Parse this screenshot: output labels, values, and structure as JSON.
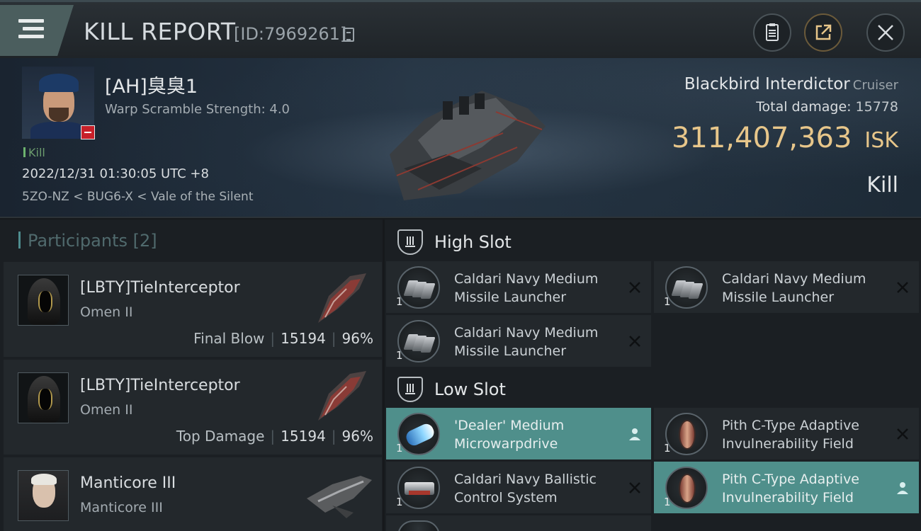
{
  "header": {
    "title": "KILL REPORT",
    "report_id": "[ID:7969261]",
    "icons": [
      "menu-icon",
      "copy-icon",
      "document-icon",
      "share-icon",
      "close-icon"
    ]
  },
  "victim": {
    "name": "[AH]臭臭1",
    "warp_scramble": "Warp Scramble Strength: 4.0",
    "tag": "Kill",
    "timestamp": "2022/12/31 01:30:05 UTC +8",
    "location": "5ZO-NZ < BUG6-X < Vale of the Silent",
    "ship_name": "Blackbird Interdictor",
    "ship_class": "Cruiser",
    "total_damage_label": "Total damage:",
    "total_damage": "15778",
    "isk_value": "311,407,363",
    "isk_unit": "ISK",
    "result": "Kill"
  },
  "participants": {
    "header": "Participants [2]",
    "items": [
      {
        "name": "[LBTY]TieInterceptor",
        "ship": "Omen II",
        "role": "Final Blow",
        "damage": "15194",
        "percent": "96%"
      },
      {
        "name": "[LBTY]TieInterceptor",
        "ship": "Omen II",
        "role": "Top Damage",
        "damage": "15194",
        "percent": "96%"
      },
      {
        "name": "Manticore III",
        "ship": "Manticore III"
      }
    ]
  },
  "fittings": {
    "high_slot": {
      "label": "High Slot",
      "modules": [
        {
          "name": "Caldari Navy Medium Missile Launcher",
          "qty": "1",
          "action_icon": "close-icon"
        },
        {
          "name": "Caldari Navy Medium Missile Launcher",
          "qty": "1",
          "action_icon": "close-icon"
        },
        {
          "name": "Caldari Navy Medium Missile Launcher",
          "qty": "1",
          "action_icon": "close-icon"
        }
      ]
    },
    "low_slot": {
      "label": "Low Slot",
      "modules": [
        {
          "name": "'Dealer' Medium Microwarpdrive",
          "qty": "1",
          "action_icon": "person-icon",
          "highlight": true
        },
        {
          "name": "Pith C-Type Adaptive Invulnerability Field",
          "qty": "1",
          "action_icon": "close-icon"
        },
        {
          "name": "Caldari Navy Ballistic Control System",
          "qty": "1",
          "action_icon": "close-icon"
        },
        {
          "name": "Pith C-Type Adaptive Invulnerability Field",
          "qty": "1",
          "action_icon": "person-icon",
          "highlight": true
        }
      ]
    }
  },
  "colors": {
    "accent_teal": "#4f8f8b",
    "isk_gold": "#e7c68a",
    "kill_green": "#6db36e"
  }
}
